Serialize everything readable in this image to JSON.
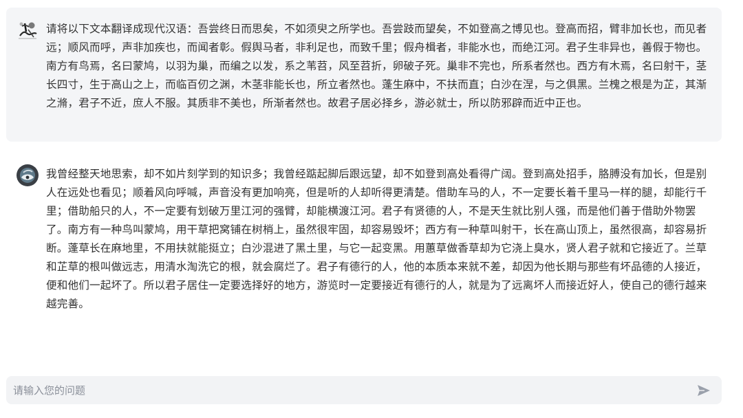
{
  "conversation": {
    "user_message": {
      "avatar_icon": "ink-painting-avatar-icon",
      "text": "请将以下文本翻译成现代汉语：吾尝终日而思矣，不如须臾之所学也。吾尝跂而望矣，不如登高之博见也。登高而招，臂非加长也，而见者远；顺风而呼，声非加疾也，而闻者彰。假舆马者，非利足也，而致千里；假舟楫者，非能水也，而绝江河。君子生非异也，善假于物也。南方有鸟焉，名曰蒙鸠，以羽为巢，而编之以发，系之苇苕，风至苕折，卵破子死。巢非不完也，所系者然也。西方有木焉，名曰射干，茎长四寸，生于高山之上，而临百仞之渊，木茎非能长也，所立者然也。蓬生麻中，不扶而直；白沙在涅，与之俱黑。兰槐之根是为芷，其渐之滫，君子不近，庶人不服。其质非不美也，所渐者然也。故君子居必择乡，游必就士，所以防邪辟而近中正也。"
    },
    "assistant_message": {
      "avatar_icon": "assistant-logo-icon",
      "text": "我曾经整天地思索，却不如片刻学到的知识多；我曾经踮起脚后跟远望，却不如登到高处看得广阔。登到高处招手，胳膊没有加长，但是别人在远处也看见；顺着风向呼喊，声音没有更加响亮，但是听的人却听得更清楚。借助车马的人，不一定要长着千里马一样的腿，却能行千里；借助船只的人，不一定要有划破万里江河的强臂，却能横渡江河。君子有贤德的人，不是天生就比别人强，而是他们善于借助外物罢了。南方有一种鸟叫蒙鸠，用干草把窝铺在树梢上，虽然很牢固，却容易毁坏；西方有一种草叫射干，长在高山顶上，虽然很高，却容易折断。蓬草长在麻地里，不用扶就能挺立；白沙混进了黑土里，与它一起变黑。用蕙草做香草却为它浇上臭水，贤人君子就和它接近了。兰草和芷草的根叫做远志，用清水淘洗它的根，就会腐烂了。君子有德行的人，他的本质本来就不差，却因为他长期与那些有坏品德的人接近，便和他们一起坏了。所以君子居住一定要选择好的地方，游览时一定要接近有德行的人，就是为了远离坏人而接近好人，使自己的德行越来越完善。"
    }
  },
  "composer": {
    "placeholder": "请输入您的问题",
    "value": "",
    "send_icon": "send-arrow-icon"
  },
  "colors": {
    "user_bubble_bg": "#f4f5f7",
    "composer_bg": "#f2f3f5",
    "text": "#333333",
    "placeholder": "#8a8f99",
    "send_icon": "#9aa0ab"
  }
}
